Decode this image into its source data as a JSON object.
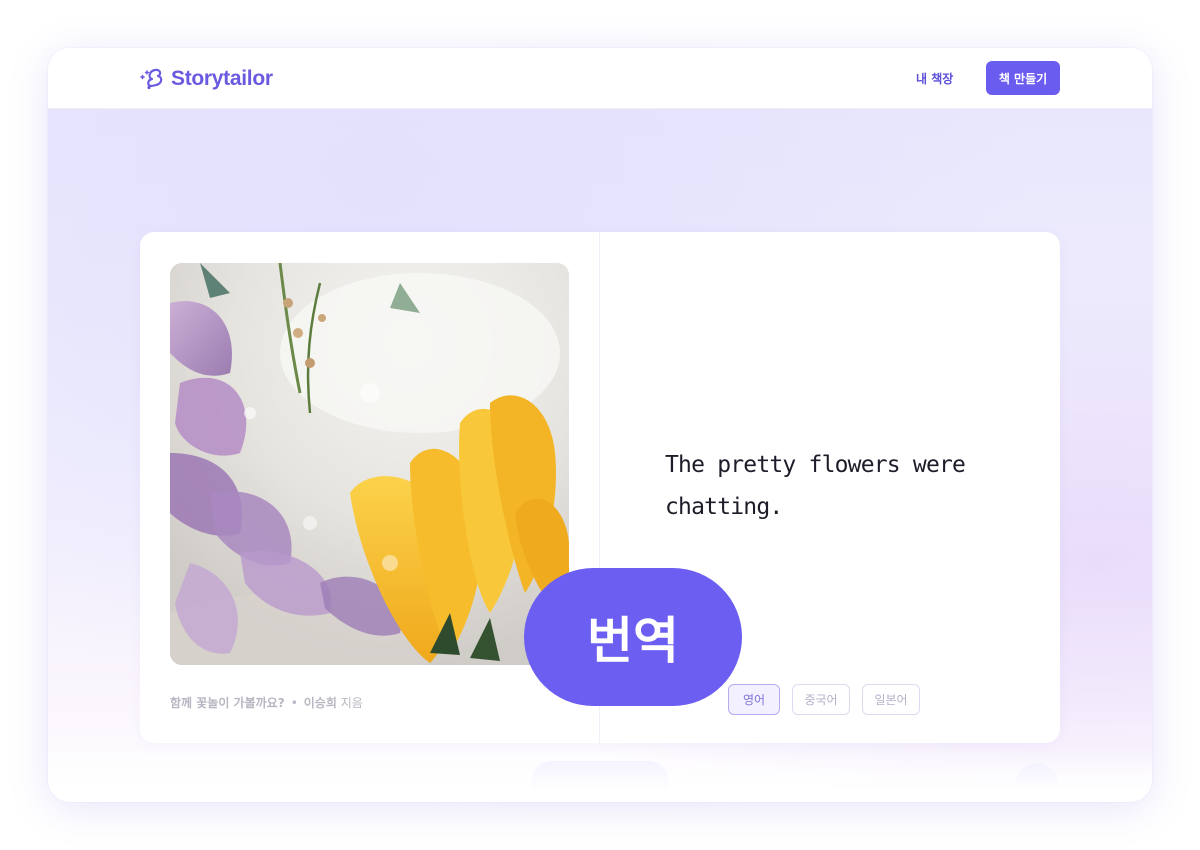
{
  "header": {
    "brand": "Storytailor",
    "nav_my_books": "내 책장",
    "make_book_label": "책 만들기"
  },
  "book": {
    "illustration_icon": "frozen-flowers-illustration",
    "caption_title": "함께 꽃놀이 가볼까요?",
    "caption_separator": "•",
    "caption_author": "이승희",
    "caption_suffix": "지음",
    "story_text": "The pretty flowers were chatting.",
    "languages": [
      {
        "label": "영어",
        "active": true
      },
      {
        "label": "중국어",
        "active": false
      },
      {
        "label": "일본어",
        "active": false
      }
    ]
  },
  "overlay": {
    "translate_label": "번역"
  },
  "colors": {
    "brand": "#6b5cf0",
    "brand_text": "#6a5ae0",
    "background_tint": "#ebe8fd"
  }
}
